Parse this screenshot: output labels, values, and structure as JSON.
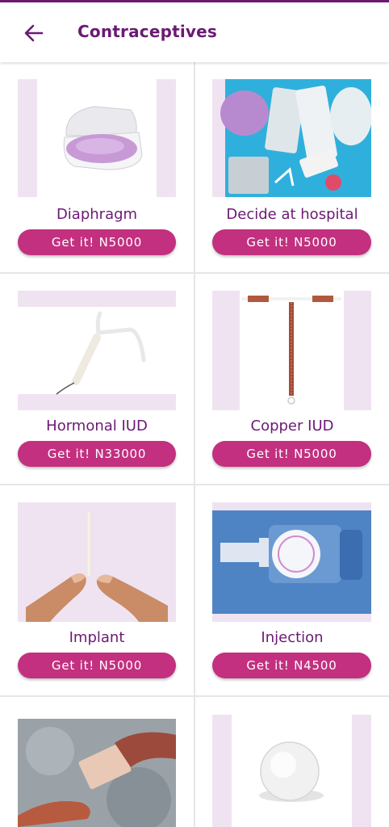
{
  "appbar": {
    "title": "Contraceptives",
    "back_icon": "arrow-left-icon"
  },
  "colors": {
    "brand": "#6b1a73",
    "button": "#c2307f",
    "thumb_bg": "#f0e3f1"
  },
  "items": [
    {
      "label": "Diaphragm",
      "button": "Get it! N5000"
    },
    {
      "label": "Decide at hospital",
      "button": "Get it! N5000"
    },
    {
      "label": "Hormonal IUD",
      "button": "Get it! N33000"
    },
    {
      "label": "Copper IUD",
      "button": "Get it! N5000"
    },
    {
      "label": "Implant",
      "button": "Get it! N5000"
    },
    {
      "label": "Injection",
      "button": "Get it! N4500"
    }
  ]
}
